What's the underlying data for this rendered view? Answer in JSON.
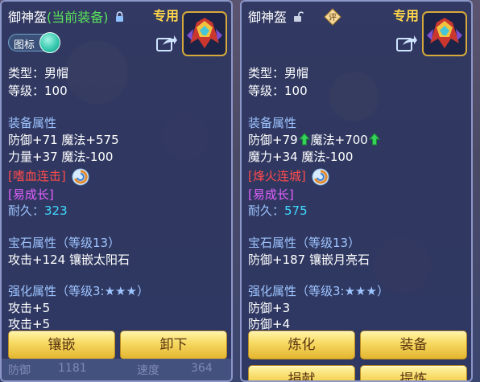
{
  "left": {
    "title_name": "御神盔",
    "title_tag": "(当前装备)",
    "special": "专用",
    "toggle_label": "图标",
    "type_line": "类型：男帽",
    "level_line": "等级：100",
    "attr_header": "装备属性",
    "attr1": "防御+71 魔法+575",
    "attr2": "力量+37 魔法-100",
    "skill": "[嗜血连击]",
    "effect": "[易成长]",
    "durability_label": "耐久：",
    "durability_value": "323",
    "gem_header": "宝石属性（等级13）",
    "gem_line": "攻击+124 镶嵌太阳石",
    "enhance_header": "强化属性（等级3:★★★）",
    "enhance1": "攻击+5",
    "enhance2": "攻击+5",
    "button1": "镶嵌",
    "button2": "卸下",
    "bg_text1": "防御",
    "bg_text2": "1181",
    "bg_text3": "速度",
    "bg_text4": "364"
  },
  "right": {
    "title_name": "御神盔",
    "badge": "评",
    "special": "专用",
    "type_line": "类型：男帽",
    "level_line": "等级：100",
    "attr_header": "装备属性",
    "attr1a": "防御+79",
    "attr1b": "魔法+700",
    "attr2": "魔力+34 魔法-100",
    "skill": "[烽火连城]",
    "effect": "[易成长]",
    "durability_label": "耐久：",
    "durability_value": "575",
    "gem_header": "宝石属性（等级13）",
    "gem_line": "防御+187 镶嵌月亮石",
    "enhance_header": "强化属性（等级3:★★★）",
    "enhance1": "防御+3",
    "enhance2": "防御+4",
    "button1": "炼化",
    "button2": "装备",
    "button3": "捐献",
    "button4": "提炼"
  },
  "colors": {
    "accent_gold": "#ffd54a",
    "equipped_tag": "#59e35a",
    "section_blue": "#9ec4ff",
    "skill_red": "#ff4b4b",
    "effect_magenta": "#e361ff",
    "durability_cyan": "#3fd9ff"
  }
}
